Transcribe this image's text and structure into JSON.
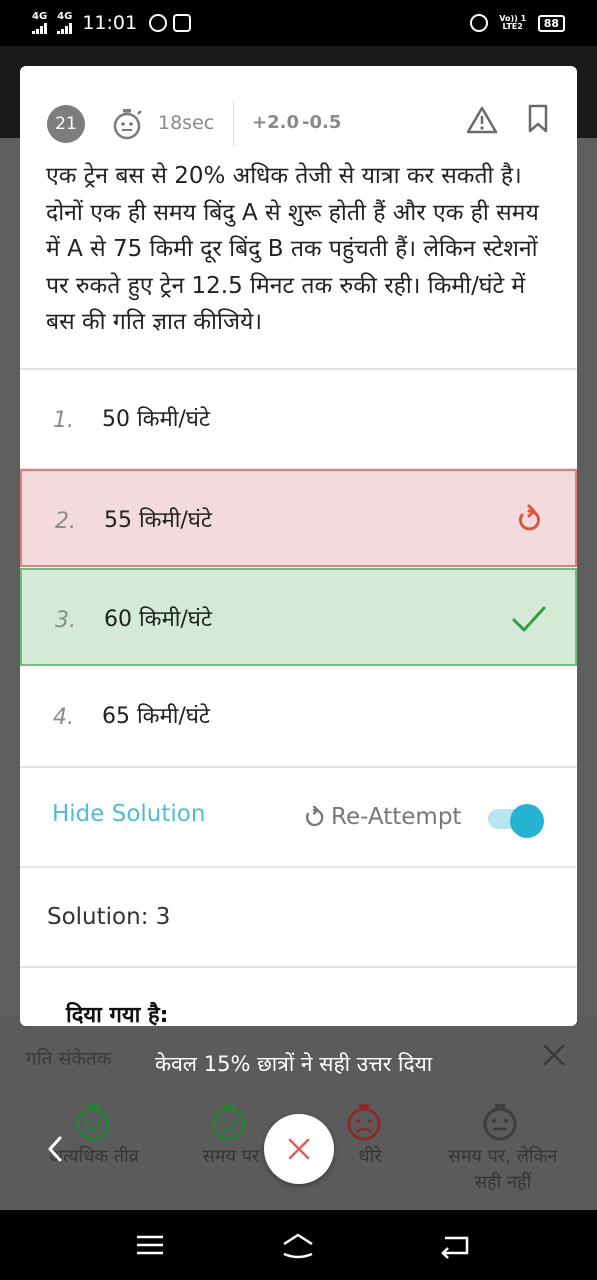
{
  "status_bar": {
    "network_1": "4G",
    "network_2": "4G",
    "time": "11:01",
    "volte": "Vo)) 1 LTE2",
    "battery": "88"
  },
  "question": {
    "number": "21",
    "time": "18sec",
    "marks_plus": "+2.0",
    "marks_minus": "-0.5",
    "text": "एक ट्रेन बस से 20% अधिक तेजी से यात्रा कर सकती है। दोनों एक ही समय बिंदु A से शुरू होती हैं और एक ही समय में A से 75 किमी दूर बिंदु B तक पहुंचती हैं। लेकिन स्टेशनों पर रुकते हुए ट्रेन 12.5 मिनट तक रुकी रही। किमी/घंटे में बस की गति ज्ञात कीजिये।"
  },
  "options": [
    {
      "num": "1.",
      "label": "50 किमी/घंटे",
      "state": "normal"
    },
    {
      "num": "2.",
      "label": "55 किमी/घंटे",
      "state": "wrong"
    },
    {
      "num": "3.",
      "label": "60 किमी/घंटे",
      "state": "correct"
    },
    {
      "num": "4.",
      "label": "65 किमी/घंटे",
      "state": "normal"
    }
  ],
  "solution_bar": {
    "hide_solution": "Hide Solution",
    "reattempt": "Re-Attempt",
    "toggle_on": true
  },
  "solution": {
    "title": "Solution: 3",
    "given_heading": "दिया गया है:"
  },
  "bottom_panel": {
    "speed_label": "गति संकेतक",
    "answer_stat": "केवल 15% छात्रों ने सही उत्तर दिया",
    "speeds": [
      {
        "label": "अत्यधिक तीव्र"
      },
      {
        "label": "समय पर"
      },
      {
        "label": "धीरे"
      },
      {
        "label": "समय पर, लेकिन सही नहीं"
      }
    ]
  },
  "colors": {
    "accent": "#27b3d3",
    "correct": "#2e9e46",
    "wrong": "#e0533f"
  }
}
